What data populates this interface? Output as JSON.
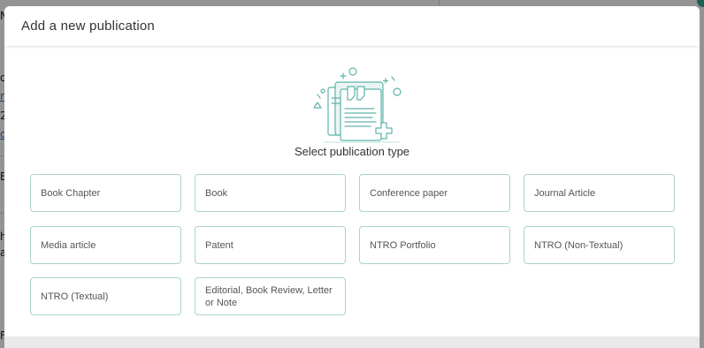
{
  "background": {
    "fragments": [
      "N",
      "o",
      "m",
      "2",
      "o",
      "E",
      "h",
      "a",
      "F"
    ]
  },
  "modal": {
    "title": "Add a new publication",
    "subtitle": "Select publication type",
    "options": [
      "Book Chapter",
      "Book",
      "Conference paper",
      "Journal Article",
      "Media article",
      "Patent",
      "NTRO Portfolio",
      "NTRO (Non-Textual)",
      "NTRO (Textual)",
      "Editorial, Book Review, Letter or Note"
    ]
  },
  "colors": {
    "accent": "#5fb3aa",
    "option_border": "#a9d3ce",
    "overlay": "#000000"
  },
  "icons": [
    "publication-illustration-icon",
    "quote-icon",
    "plus-icon"
  ]
}
